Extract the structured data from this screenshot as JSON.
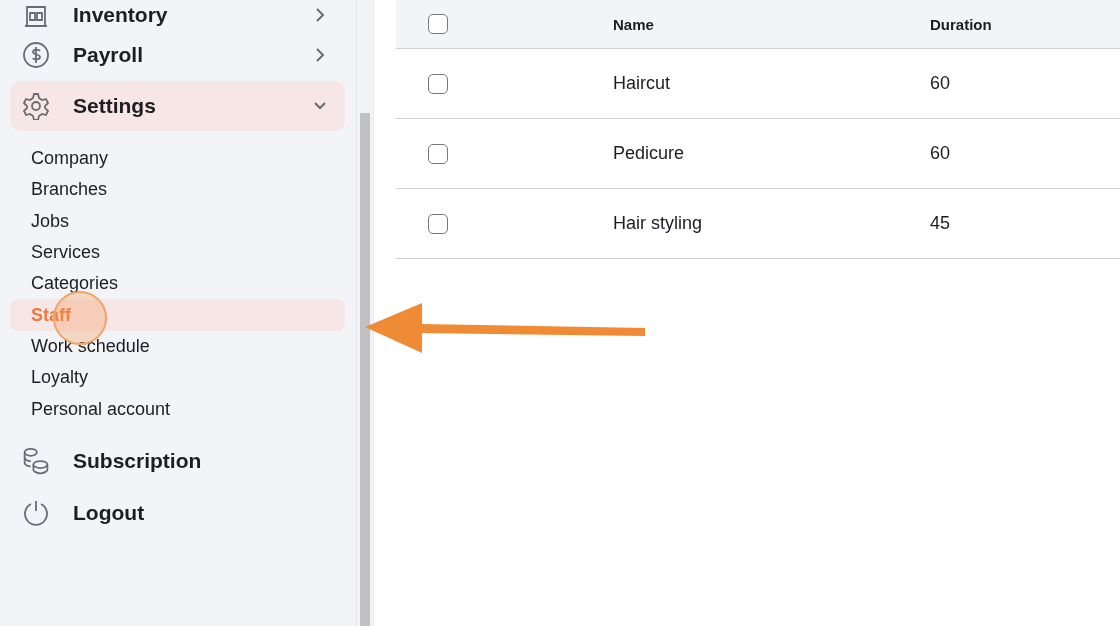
{
  "nav": [
    {
      "label": "Inventory",
      "kind": "group",
      "expanded": false,
      "selected": false
    },
    {
      "label": "Payroll",
      "kind": "group",
      "expanded": false,
      "selected": false
    },
    {
      "label": "Settings",
      "kind": "group",
      "expanded": true,
      "selected": true,
      "children": [
        {
          "label": "Company",
          "selected": false
        },
        {
          "label": "Branches",
          "selected": false
        },
        {
          "label": "Jobs",
          "selected": false
        },
        {
          "label": "Services",
          "selected": false
        },
        {
          "label": "Categories",
          "selected": false
        },
        {
          "label": "Staff",
          "selected": true
        },
        {
          "label": "Work schedule",
          "selected": false
        },
        {
          "label": "Loyalty",
          "selected": false
        },
        {
          "label": "Personal account",
          "selected": false
        }
      ]
    },
    {
      "label": "Subscription",
      "kind": "link",
      "selected": false
    },
    {
      "label": "Logout",
      "kind": "link",
      "selected": false
    }
  ],
  "table": {
    "header_checked": false,
    "columns": [
      "Name",
      "Duration"
    ],
    "rows": [
      {
        "checked": false,
        "cells": [
          "Haircut",
          "60"
        ]
      },
      {
        "checked": false,
        "cells": [
          "Pedicure",
          "60"
        ]
      },
      {
        "checked": false,
        "cells": [
          "Hair styling",
          "45"
        ]
      }
    ]
  }
}
